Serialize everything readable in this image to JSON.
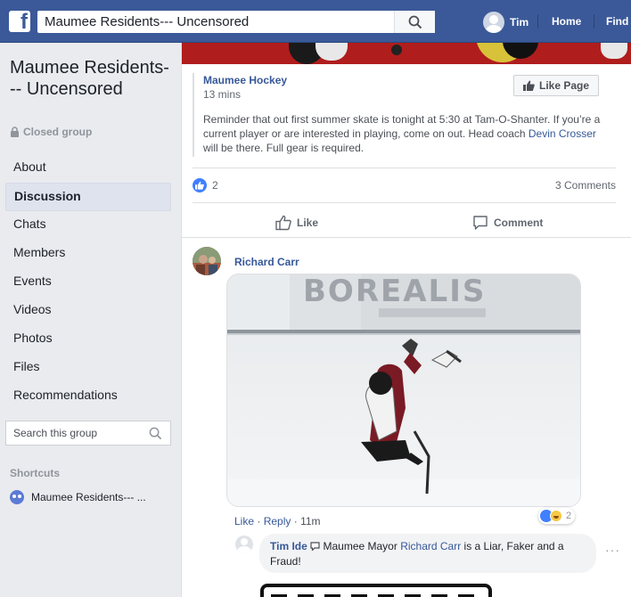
{
  "topbar": {
    "logo": "f",
    "search_value": "Maumee Residents--- Uncensored",
    "user_name": "Tim",
    "links": [
      "Home",
      "Find"
    ]
  },
  "sidebar": {
    "group_name": "Maumee Residents--- Uncensored",
    "privacy": "Closed group",
    "nav": [
      {
        "label": "About",
        "active": false
      },
      {
        "label": "Discussion",
        "active": true
      },
      {
        "label": "Chats",
        "active": false
      },
      {
        "label": "Members",
        "active": false
      },
      {
        "label": "Events",
        "active": false
      },
      {
        "label": "Videos",
        "active": false
      },
      {
        "label": "Photos",
        "active": false
      },
      {
        "label": "Files",
        "active": false
      },
      {
        "label": "Recommendations",
        "active": false
      }
    ],
    "search_placeholder": "Search this group",
    "shortcuts_heading": "Shortcuts",
    "shortcut_label": "Maumee Residents--- ..."
  },
  "post": {
    "page_name": "Maumee Hockey",
    "time": "13 mins",
    "like_page_label": "Like Page",
    "body_1": "Reminder that out first summer skate is tonight at 5:30 at Tam-O-Shanter. If you’re a current player or are interested in playing, come on out. Head coach ",
    "body_link": "Devin Crosser",
    "body_2": " will be there. Full gear is required.",
    "reaction_count": "2",
    "comments_count": "3 Comments",
    "like_action": "Like",
    "comment_action": "Comment"
  },
  "comment": {
    "author": "Richard Carr",
    "gif_text": "BOREALIS",
    "like": "Like",
    "dot": "·",
    "reply": "Reply",
    "time": "11m",
    "reaction_count": "2"
  },
  "reply": {
    "author": "Tim Ide",
    "text_1": " Maumee Mayor ",
    "link": "Richard Carr",
    "text_2": " is a Liar, Faker and a Fraud!",
    "more": "···"
  },
  "colors": {
    "brand": "#3b5998",
    "link": "#365899",
    "like_blue": "#4080ff"
  }
}
